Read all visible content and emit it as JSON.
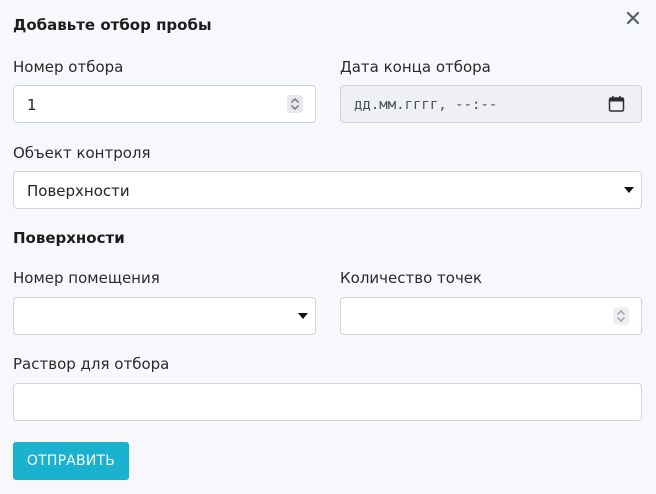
{
  "modal": {
    "title": "Добавьте отбор пробы"
  },
  "fields": {
    "sample_number": {
      "label": "Номер отбора",
      "value": "1"
    },
    "end_date": {
      "label": "Дата конца отбора",
      "placeholder": "дд.мм.гггг, --:--"
    },
    "control_object": {
      "label": "Объект контроля",
      "value": "Поверхности"
    }
  },
  "section": {
    "title": "Поверхности"
  },
  "surfaces": {
    "room_number": {
      "label": "Номер помещения",
      "value": ""
    },
    "points_count": {
      "label": "Количество точек",
      "value": ""
    },
    "solution": {
      "label": "Раствор для отбора",
      "value": ""
    }
  },
  "actions": {
    "submit_label": "ОТПРАВИТЬ"
  },
  "colors": {
    "accent": "#1ab2cf",
    "background": "#f7f8fb",
    "border": "#cfd4da"
  },
  "icons": {
    "close": "close-icon",
    "calendar": "calendar-icon",
    "spinner": "number-spinner-icon",
    "dropdown": "chevron-down-icon"
  }
}
